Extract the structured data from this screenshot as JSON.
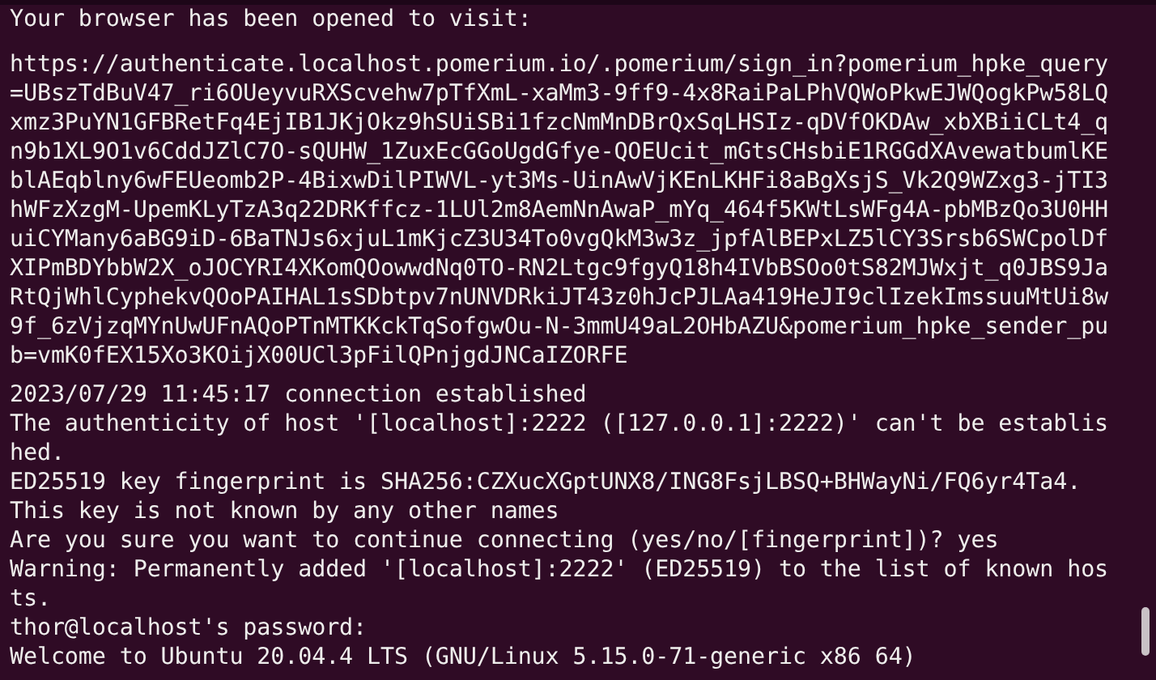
{
  "terminal": {
    "blocks": [
      {
        "lines": [
          "Your browser has been opened to visit:"
        ]
      },
      {
        "lines": [
          "https://authenticate.localhost.pomerium.io/.pomerium/sign_in?pomerium_hpke_query",
          "=UBszTdBuV47_ri6OUeyvuRXScvehw7pTfXmL-xaMm3-9ff9-4x8RaiPaLPhVQWoPkwEJWQogkPw58LQ",
          "xmz3PuYN1GFBRetFq4EjIB1JKjOkz9hSUiSBi1fzcNmMnDBrQxSqLHSIz-qDVfOKDAw_xbXBiiCLt4_q",
          "n9b1XL9O1v6CddJZlC7O-sQUHW_1ZuxEcGGoUgdGfye-QOEUcit_mGtsCHsbiE1RGGdXAvewatbumlKE",
          "blAEqblny6wFEUeomb2P-4BixwDilPIWVL-yt3Ms-UinAwVjKEnLKHFi8aBgXsjS_Vk2Q9WZxg3-jTI3",
          "hWFzXzgM-UpemKLyTzA3q22DRKffcz-1LUl2m8AemNnAwaP_mYq_464f5KWtLsWFg4A-pbMBzQo3U0HH",
          "uiCYMany6aBG9iD-6BaTNJs6xjuL1mKjcZ3U34To0vgQkM3w3z_jpfAlBEPxLZ5lCY3Srsb6SWCpolDf",
          "XIPmBDYbbW2X_oJOCYRI4XKomQOowwdNq0TO-RN2Ltgc9fgyQ18h4IVbBSOo0tS82MJWxjt_q0JBS9Ja",
          "RtQjWhlCyphekvQOoPAIHAL1sSDbtpv7nUNVDRkiJT43z0hJcPJLAa419HeJI9clIzekImssuuMtUi8w",
          "9f_6zVjzqMYnUwUFnAQoPTnMTKKckTqSofgwOu-N-3mmU49aL2OHbAZU&pomerium_hpke_sender_pu",
          "b=vmK0fEX15Xo3KOijX00UCl3pFilQPnjgdJNCaIZORFE"
        ]
      },
      {
        "lines": [
          "2023/07/29 11:45:17 connection established",
          "The authenticity of host '[localhost]:2222 ([127.0.0.1]:2222)' can't be establis",
          "hed.",
          "ED25519 key fingerprint is SHA256:CZXucXGptUNX8/ING8FsjLBSQ+BHWayNi/FQ6yr4Ta4.",
          "This key is not known by any other names",
          "Are you sure you want to continue connecting (yes/no/[fingerprint])? yes",
          "Warning: Permanently added '[localhost]:2222' (ED25519) to the list of known hos",
          "ts.",
          "thor@localhost's password:",
          "Welcome to Ubuntu 20.04.4 LTS (GNU/Linux 5.15.0-71-generic x86 64)"
        ]
      }
    ]
  }
}
